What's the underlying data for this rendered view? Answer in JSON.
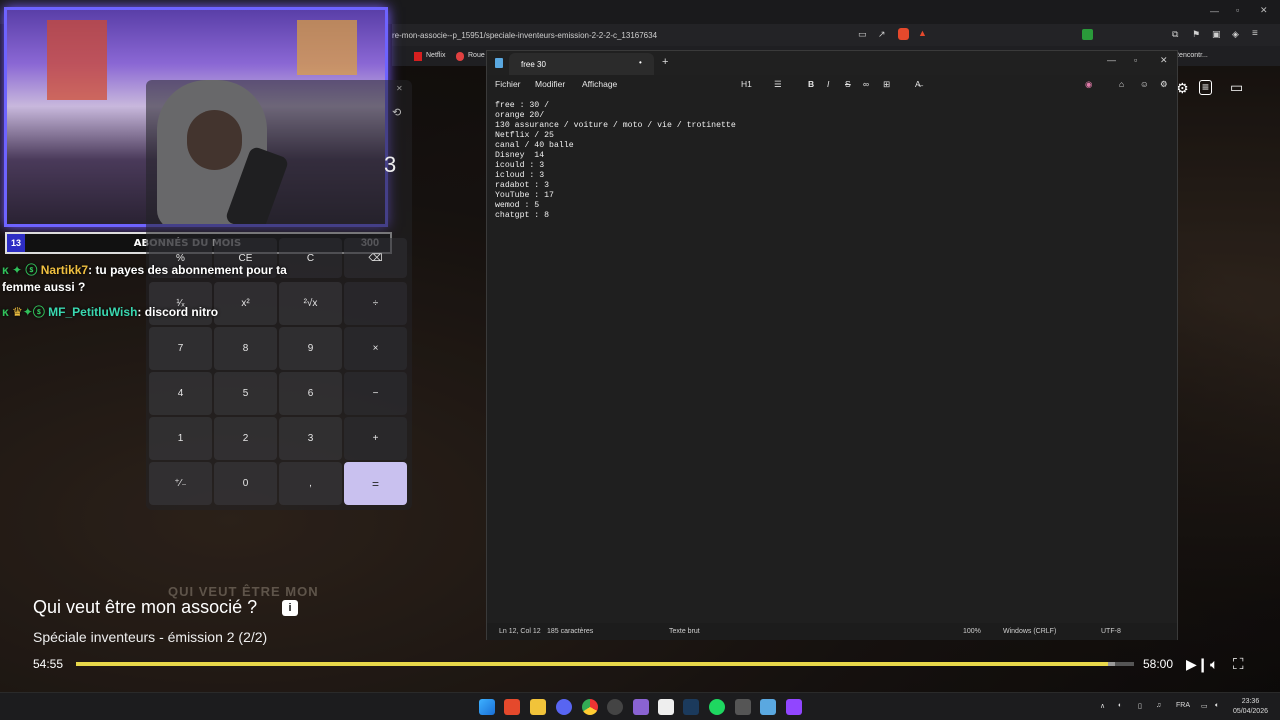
{
  "browser": {
    "url": "re-mon-associe--p_15951/speciale-inventeurs-emission-2-2-2-c_13167634",
    "bookmarks": [
      "Netflix",
      "Roue"
    ],
    "bookmark_right": "Rencontr..."
  },
  "stream": {
    "subs_count": "13",
    "subs_label": "ABONNÉS DU MOIS",
    "subs_goal": "300",
    "chat": [
      {
        "user": "Nartikk7",
        "message": ": tu payes des abonnement pour ta",
        "message2": "femme aussi ?"
      },
      {
        "user": "MF_PetitluWish",
        "message": ": discord nitro"
      }
    ]
  },
  "calculator": {
    "display": "3",
    "memory_row": [
      "%",
      "CE",
      "C",
      "⌫"
    ],
    "keys": [
      [
        "¹⁄ₓ",
        "x²",
        "²√x",
        "÷"
      ],
      [
        "7",
        "8",
        "9",
        "×"
      ],
      [
        "4",
        "5",
        "6",
        "−"
      ],
      [
        "1",
        "2",
        "3",
        "+"
      ],
      [
        "⁺⁄₋",
        "0",
        ",",
        "="
      ]
    ]
  },
  "notepad": {
    "tab_title": "free 30",
    "new_tab": "+",
    "menu": [
      "Fichier",
      "Modifier",
      "Affichage"
    ],
    "heading_btn": "H1",
    "lines": [
      "free : 30 /",
      "orange 20/",
      "130 assurance / voiture / moto / vie / trotinette",
      "Netflix / 25",
      "canal / 40 balle",
      "Disney  14",
      "icould : 3",
      "icloud : 3",
      "radabot : 3",
      "YouTube : 17",
      "wemod : 5",
      "chatgpt : 8"
    ],
    "status": {
      "position": "Ln 12, Col 12",
      "chars": "185 caractères",
      "format": "Texte brut",
      "zoom": "100%",
      "line_ending": "Windows (CRLF)",
      "encoding": "UTF-8"
    }
  },
  "video": {
    "title": "Qui veut être mon associé ?",
    "subtitle": "Spéciale inventeurs - émission 2 (2/2)",
    "current_time": "54:55",
    "duration": "58:00",
    "progress": 0.975,
    "buffer": 0.982
  },
  "taskbar": {
    "language": "FRA",
    "time": "23:36",
    "date": "05/04/2026"
  }
}
